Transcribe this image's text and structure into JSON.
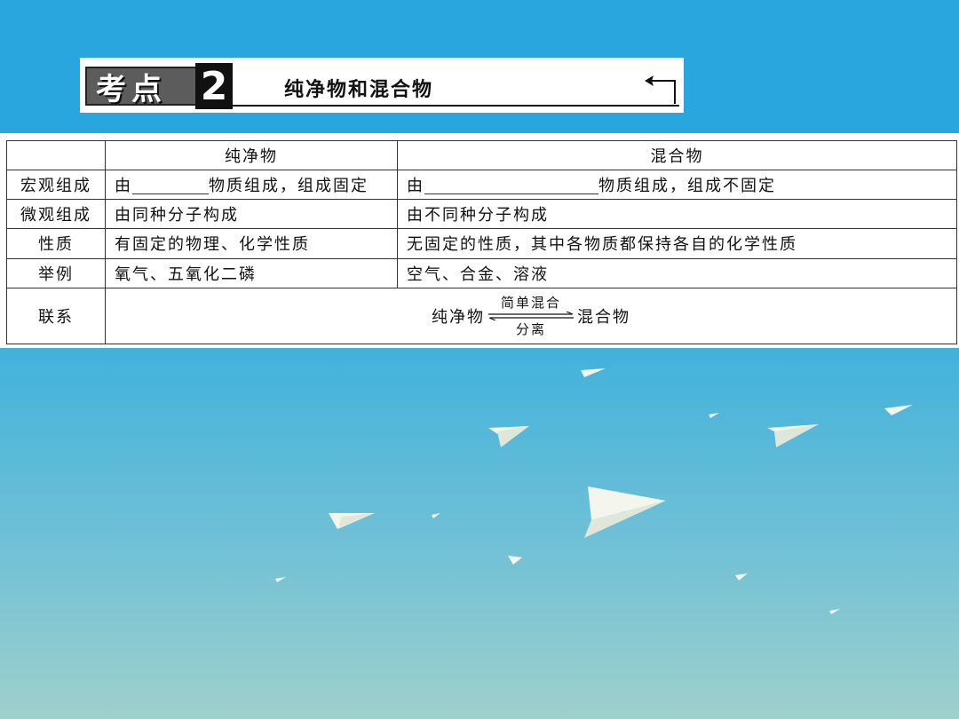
{
  "banner": {
    "badge_text": "考点",
    "badge_number": "2",
    "title": "纯净物和混合物"
  },
  "table": {
    "headers": [
      "",
      "纯净物",
      "混合物"
    ],
    "rows": [
      {
        "label": "宏观组成",
        "pure": {
          "before": "由",
          "after": "物质组成，组成固定"
        },
        "mixture": {
          "before": "由",
          "after": "物质组成，组成不固定"
        }
      },
      {
        "label": "微观组成",
        "pure": "由同种分子构成",
        "mixture": "由不同种分子构成"
      },
      {
        "label": "性质",
        "pure": "有固定的物理、化学性质",
        "mixture": "无固定的性质，其中各物质都保持各自的化学性质"
      },
      {
        "label": "举例",
        "pure": "氧气、五氧化二磷",
        "mixture": "空气、合金、溶液"
      }
    ],
    "relation": {
      "label": "联系",
      "left": "纯净物",
      "top_arrow": "简单混合",
      "bottom_arrow": "分离",
      "right": "混合物"
    }
  },
  "colors": {
    "sky_top": "#2aa6de",
    "sky_bottom": "#9fd0cb",
    "badge_gray": "#5c5c5c",
    "plane": "#f4f6ee"
  },
  "icons": [
    "return-arrow-icon",
    "paper-plane-icon"
  ]
}
